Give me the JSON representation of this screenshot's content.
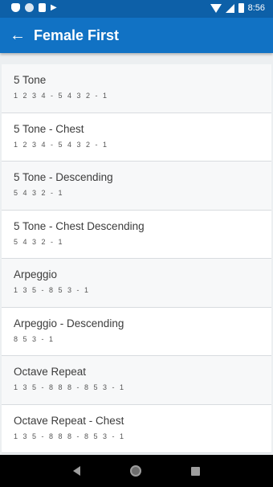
{
  "status_bar": {
    "time": "8:56",
    "icons_left": [
      "shield-icon",
      "circle-icon",
      "sd-card-icon",
      "play-store-icon"
    ],
    "icons_right": [
      "wifi-icon",
      "signal-icon",
      "battery-icon"
    ]
  },
  "header": {
    "title": "Female First",
    "back_icon": "←"
  },
  "exercises": [
    {
      "title": "5 Tone",
      "pattern": "1 2 3 4 - 5 4 3 2 - 1"
    },
    {
      "title": "5 Tone - Chest",
      "pattern": "1 2 3 4 - 5 4 3 2 - 1"
    },
    {
      "title": "5 Tone - Descending",
      "pattern": "5 4 3 2 - 1"
    },
    {
      "title": "5 Tone - Chest Descending",
      "pattern": "5 4 3 2 - 1"
    },
    {
      "title": "Arpeggio",
      "pattern": "1 3 5 - 8 5 3 - 1"
    },
    {
      "title": "Arpeggio - Descending",
      "pattern": "8 5 3 - 1"
    },
    {
      "title": "Octave Repeat",
      "pattern": "1 3 5 - 8 8 8 - 8 5 3 - 1"
    },
    {
      "title": "Octave Repeat - Chest",
      "pattern": "1 3 5 - 8 8 8 - 8 5 3 - 1"
    }
  ],
  "colors": {
    "status_bar": "#0d60a8",
    "app_bar": "#1172c4",
    "background": "#eceff1",
    "nav_bar": "#000000"
  }
}
